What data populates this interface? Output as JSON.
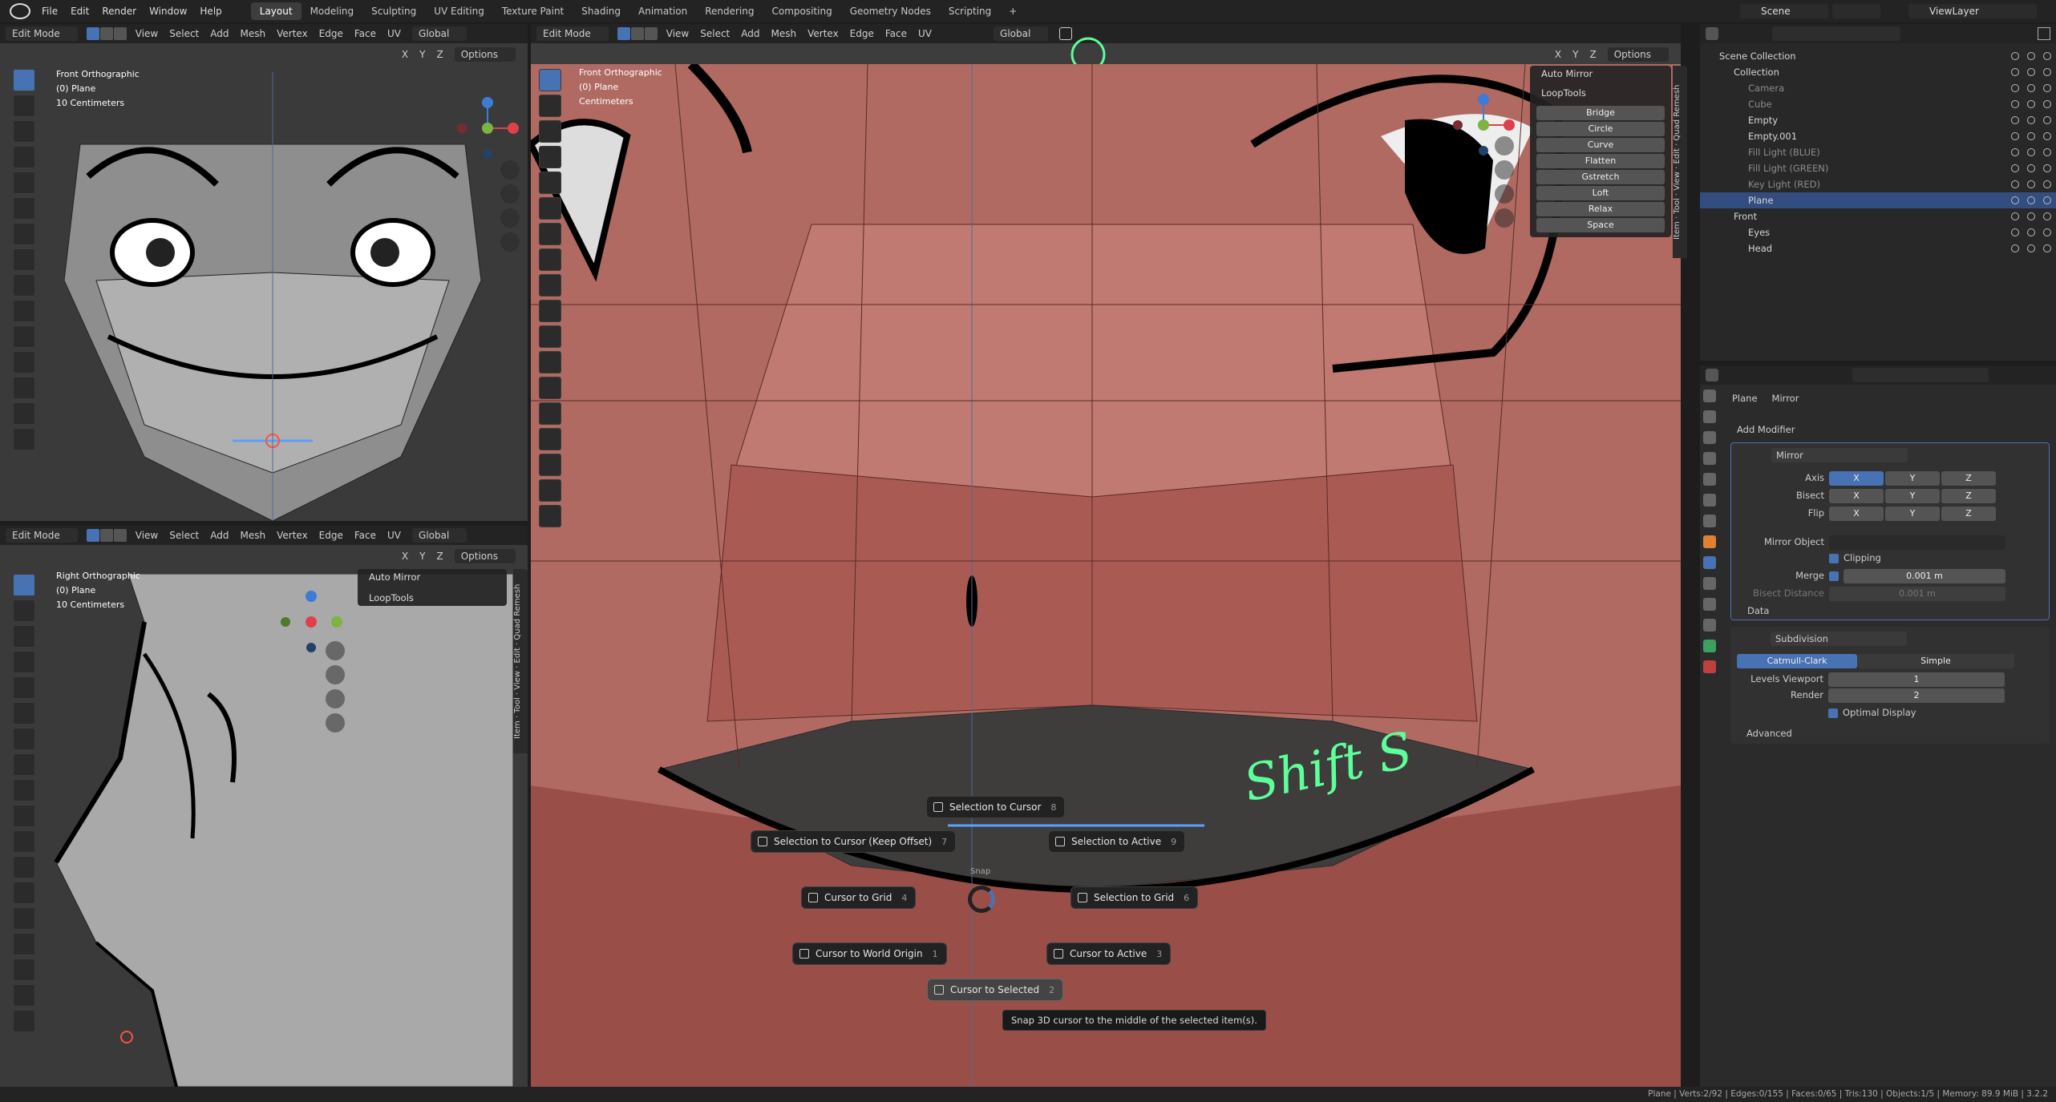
{
  "menubar": {
    "items": [
      "File",
      "Edit",
      "Render",
      "Window",
      "Help"
    ],
    "workspaces": [
      "Layout",
      "Modeling",
      "Sculpting",
      "UV Editing",
      "Texture Paint",
      "Shading",
      "Animation",
      "Rendering",
      "Compositing",
      "Geometry Nodes",
      "Scripting"
    ],
    "active_workspace": "Layout",
    "add_tab": "+",
    "scene": "Scene",
    "view_layer": "ViewLayer"
  },
  "header_common": {
    "mode": "Edit Mode",
    "view": "View",
    "select": "Select",
    "add": "Add",
    "mesh": "Mesh",
    "vertex": "Vertex",
    "edge": "Edge",
    "face": "Face",
    "uv": "UV",
    "orientation": "Global",
    "options": "Options",
    "axis_x": "X",
    "axis_y": "Y",
    "axis_z": "Z"
  },
  "vp_top_left": {
    "view_name": "Front Orthographic",
    "object": "(0) Plane",
    "scale": "10 Centimeters"
  },
  "vp_bottom_left": {
    "view_name": "Right Orthographic",
    "object": "(0) Plane",
    "scale": "10 Centimeters",
    "panel_auto_mirror": "Auto Mirror",
    "panel_looptools": "LoopTools"
  },
  "vp_main": {
    "view_name": "Front Orthographic",
    "object": "(0) Plane",
    "scale": "Centimeters",
    "panel_auto_mirror": "Auto Mirror",
    "panel_looptools": "LoopTools",
    "looptools_items": [
      "Bridge",
      "Circle",
      "Curve",
      "Flatten",
      "Gstretch",
      "Loft",
      "Relax",
      "Space"
    ],
    "side_tabs": [
      "Item",
      "Tool",
      "View",
      "Edit",
      "Quad Remesh"
    ],
    "handwriting": "Shift S"
  },
  "pie_menu": {
    "items": [
      {
        "label": "Selection to Cursor",
        "key": "8"
      },
      {
        "label": "Selection to Cursor (Keep Offset)",
        "key": "7"
      },
      {
        "label": "Selection to Active",
        "key": "9"
      },
      {
        "label": "Cursor to Grid",
        "key": "4"
      },
      {
        "label": "Selection to Grid",
        "key": "6"
      },
      {
        "label": "Cursor to World Origin",
        "key": "1"
      },
      {
        "label": "Cursor to Active",
        "key": "3"
      },
      {
        "label": "Cursor to Selected",
        "key": "2"
      }
    ],
    "center_label": "Snap",
    "tooltip": "Snap 3D cursor to the middle of the selected item(s)."
  },
  "outliner": {
    "rows": [
      {
        "label": "Scene Collection",
        "indent": 0,
        "selected": false,
        "dim": false
      },
      {
        "label": "Collection",
        "indent": 1,
        "selected": false,
        "dim": false
      },
      {
        "label": "Camera",
        "indent": 2,
        "selected": false,
        "dim": true
      },
      {
        "label": "Cube",
        "indent": 2,
        "selected": false,
        "dim": true
      },
      {
        "label": "Empty",
        "indent": 2,
        "selected": false,
        "dim": false
      },
      {
        "label": "Empty.001",
        "indent": 2,
        "selected": false,
        "dim": false
      },
      {
        "label": "Fill Light (BLUE)",
        "indent": 2,
        "selected": false,
        "dim": true
      },
      {
        "label": "Fill Light (GREEN)",
        "indent": 2,
        "selected": false,
        "dim": true
      },
      {
        "label": "Key Light (RED)",
        "indent": 2,
        "selected": false,
        "dim": true
      },
      {
        "label": "Plane",
        "indent": 2,
        "selected": true,
        "dim": false
      },
      {
        "label": "Front",
        "indent": 1,
        "selected": false,
        "dim": false
      },
      {
        "label": "Eyes",
        "indent": 2,
        "selected": false,
        "dim": false
      },
      {
        "label": "Head",
        "indent": 2,
        "selected": false,
        "dim": false
      }
    ]
  },
  "properties": {
    "breadcrumb_object": "Plane",
    "breadcrumb_modifier": "Mirror",
    "add_modifier": "Add Modifier",
    "mirror": {
      "name": "Mirror",
      "axis_label": "Axis",
      "bisect_label": "Bisect",
      "flip_label": "Flip",
      "mirror_object_label": "Mirror Object",
      "clipping_label": "Clipping",
      "merge_label": "Merge",
      "merge_value": "0.001 m",
      "bisect_distance_label": "Bisect Distance",
      "bisect_distance_value": "0.001 m",
      "data_label": "Data"
    },
    "subdivision": {
      "name": "Subdivision",
      "catmull_clark": "Catmull-Clark",
      "simple": "Simple",
      "levels_viewport_label": "Levels Viewport",
      "levels_viewport_value": "1",
      "render_label": "Render",
      "render_value": "2",
      "optimal_display_label": "Optimal Display",
      "advanced_label": "Advanced"
    }
  },
  "statusbar": {
    "text": "Plane | Verts:2/92 | Edges:0/155 | Faces:0/65 | Tris:130 | Objects:1/5 | Memory: 89.9 MiB | 3.2.2"
  },
  "colors": {
    "accent": "#4772b3",
    "face_skin": "#a85a52",
    "annotation": "#5dff9a"
  }
}
